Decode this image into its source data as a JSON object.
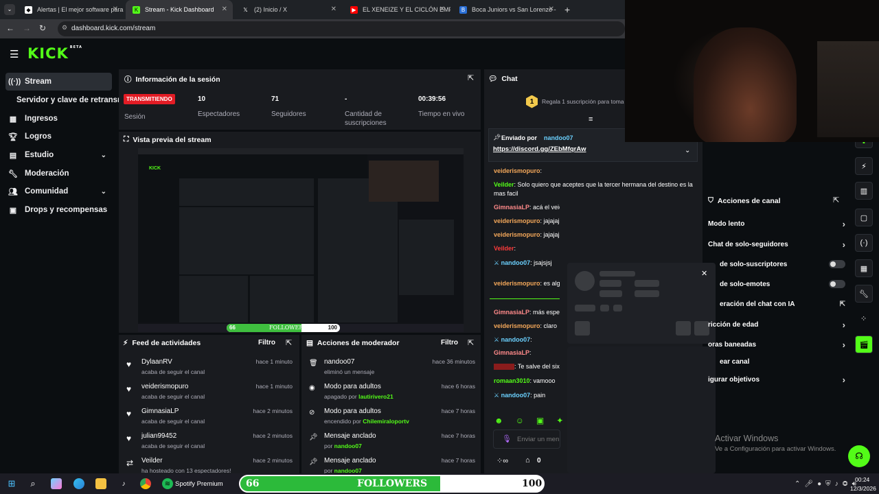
{
  "browser": {
    "tabs": [
      {
        "title": "Alertas | El mejor software para"
      },
      {
        "title": "Stream - Kick Dashboard"
      },
      {
        "title": "(2) Inicio / X"
      },
      {
        "title": "EL XENEIZE Y EL CICLÓN EMPAT"
      },
      {
        "title": "Boca Juniors vs San Lorenzo - "
      }
    ],
    "url": "dashboard.kick.com/stream"
  },
  "brand": {
    "logo": "KICK",
    "badge": "BETA",
    "accent": "#53fc18"
  },
  "sidebar": {
    "items": [
      {
        "label": "Stream",
        "icon": "broadcast-icon"
      },
      {
        "label": "Servidor y clave de retransm"
      },
      {
        "label": "Ingresos",
        "icon": "chart-icon"
      },
      {
        "label": "Logros",
        "icon": "trophy-icon"
      },
      {
        "label": "Estudio",
        "icon": "studio-icon"
      },
      {
        "label": "Moderación",
        "icon": "wrench-icon"
      },
      {
        "label": "Comunidad",
        "icon": "users-icon"
      },
      {
        "label": "Drops y recompensas",
        "icon": "gift-icon"
      }
    ]
  },
  "session": {
    "title": "Información de la sesión",
    "status": "TRANSMITIENDO",
    "status_label": "Sesión",
    "stats": [
      {
        "value": "10",
        "label": "Espectadores"
      },
      {
        "value": "71",
        "label": "Seguidores"
      },
      {
        "value": "-",
        "label": "Cantidad de suscripciones"
      },
      {
        "value": "00:39:56",
        "label": "Tiempo en vivo"
      }
    ]
  },
  "preview": {
    "title": "Vista previa del stream"
  },
  "overlay": {
    "left": "66",
    "mid": "FOLLOWERS",
    "right": "100",
    "progress": 0.66
  },
  "feed": {
    "title": "Feed de actividades",
    "filter": "Filtro",
    "items": [
      {
        "name": "DylaanRV",
        "desc": "acaba de seguir el canal",
        "time": "hace 1 minuto"
      },
      {
        "name": "veiderismopuro",
        "desc": "acaba de seguir el canal",
        "time": "hace 1 minuto"
      },
      {
        "name": "GimnasiaLP",
        "desc": "acaba de seguir el canal",
        "time": "hace 2 minutos"
      },
      {
        "name": "julian99452",
        "desc": "acaba de seguir el canal",
        "time": "hace 2 minutos"
      },
      {
        "name": "Veilder",
        "desc": "ha hosteado con 13 espectadores!",
        "time": "hace 2 minutos"
      }
    ]
  },
  "modactions": {
    "title": "Acciones de moderador",
    "filter": "Filtro",
    "items": [
      {
        "name": "nandoo07",
        "desc": "eliminó un mensaje",
        "user": "",
        "time": "hace 36 minutos"
      },
      {
        "name": "Modo para adultos",
        "desc": "apagado por",
        "user": "lautirivero21",
        "time": "hace 6 horas"
      },
      {
        "name": "Modo para adultos",
        "desc": "encendido por",
        "user": "Chilemiraloportv",
        "time": "hace 7 horas"
      },
      {
        "name": "Mensaje anclado",
        "desc": "por",
        "user": "nandoo07",
        "time": "hace 7 horas"
      },
      {
        "name": "Mensaje anclado",
        "desc": "por",
        "user": "nandoo07",
        "time": "hace 7 horas"
      }
    ]
  },
  "chat": {
    "title": "Chat",
    "gift": "Regala 1 suscripción para toma",
    "pinned_by": "Enviado por",
    "pinned_user": "nandoo07",
    "pinned_link": "https://discord.gg/ZEbMfqrAw",
    "messages": [
      {
        "user": "veiderismopuro",
        "color": "#f4a85a",
        "text": ":"
      },
      {
        "user": "Veilder",
        "color": "#53fc18",
        "text": ": Solo quiero que aceptes que la tercer hermana del destino es la mas facil"
      },
      {
        "user": "GimnasiaLP",
        "color": "#ff8a8a",
        "text": ": acá el veiderismo presente"
      },
      {
        "user": "veiderismopuro",
        "color": "#f4a85a",
        "text": ": jajajajajaj"
      },
      {
        "user": "veiderismopuro",
        "color": "#f4a85a",
        "text": ": jajajajajaj"
      },
      {
        "user": "Veilder",
        "color": "#ff3b3b",
        "text": ":"
      },
      {
        "reply": "Respondiendo a Veilde",
        "user": "nandoo07",
        "color": "#6bd1ff",
        "text": ": jsajsjsj"
      },
      {
        "user": "veiderismopuro",
        "color": "#f4a85a",
        "text": ": es alg"
      },
      {
        "user": "GimnasiaLP",
        "color": "#ff8a8a",
        "text": ": más espec"
      },
      {
        "user": "veiderismopuro",
        "color": "#f4a85a",
        "text": ": claro"
      },
      {
        "user": "nandoo07",
        "color": "#6bd1ff",
        "text": ":"
      },
      {
        "user": "GimnasiaLP",
        "color": "#ff8a8a",
        "text": ":"
      },
      {
        "user": "",
        "color": "#ff3b3b",
        "text": ": Te salve del six"
      },
      {
        "user": "romaan3010",
        "color": "#53fc18",
        "text": ": vamooo"
      },
      {
        "reply": "Respondiendo a Veilde",
        "user": "nandoo07",
        "color": "#6bd1ff",
        "text": ": pain"
      }
    ],
    "input_placeholder": "Enviar un men",
    "footer_count": "0"
  },
  "channel_actions": {
    "title": "Acciones de canal",
    "items": [
      {
        "label": "Modo lento",
        "type": "arrow"
      },
      {
        "label": "Chat de solo-seguidores",
        "type": "arrow"
      },
      {
        "label": "de solo-suscriptores",
        "type": "toggle"
      },
      {
        "label": "de solo-emotes",
        "type": "toggle"
      },
      {
        "label": "eración del chat con IA",
        "type": "link"
      },
      {
        "label": "ricción de edad",
        "type": "arrow"
      },
      {
        "label": "oras baneadas",
        "type": "arrow"
      },
      {
        "label": "ear canal",
        "type": "none"
      },
      {
        "label": "igurar objetivos",
        "type": "arrow"
      }
    ]
  },
  "watermark": {
    "line1": "Activar Windows",
    "line2": "Ve a Configuración para activar Windows."
  },
  "taskbar": {
    "spotify": "Spotify Premium",
    "time": "00:24",
    "date": "12/3/2026"
  }
}
